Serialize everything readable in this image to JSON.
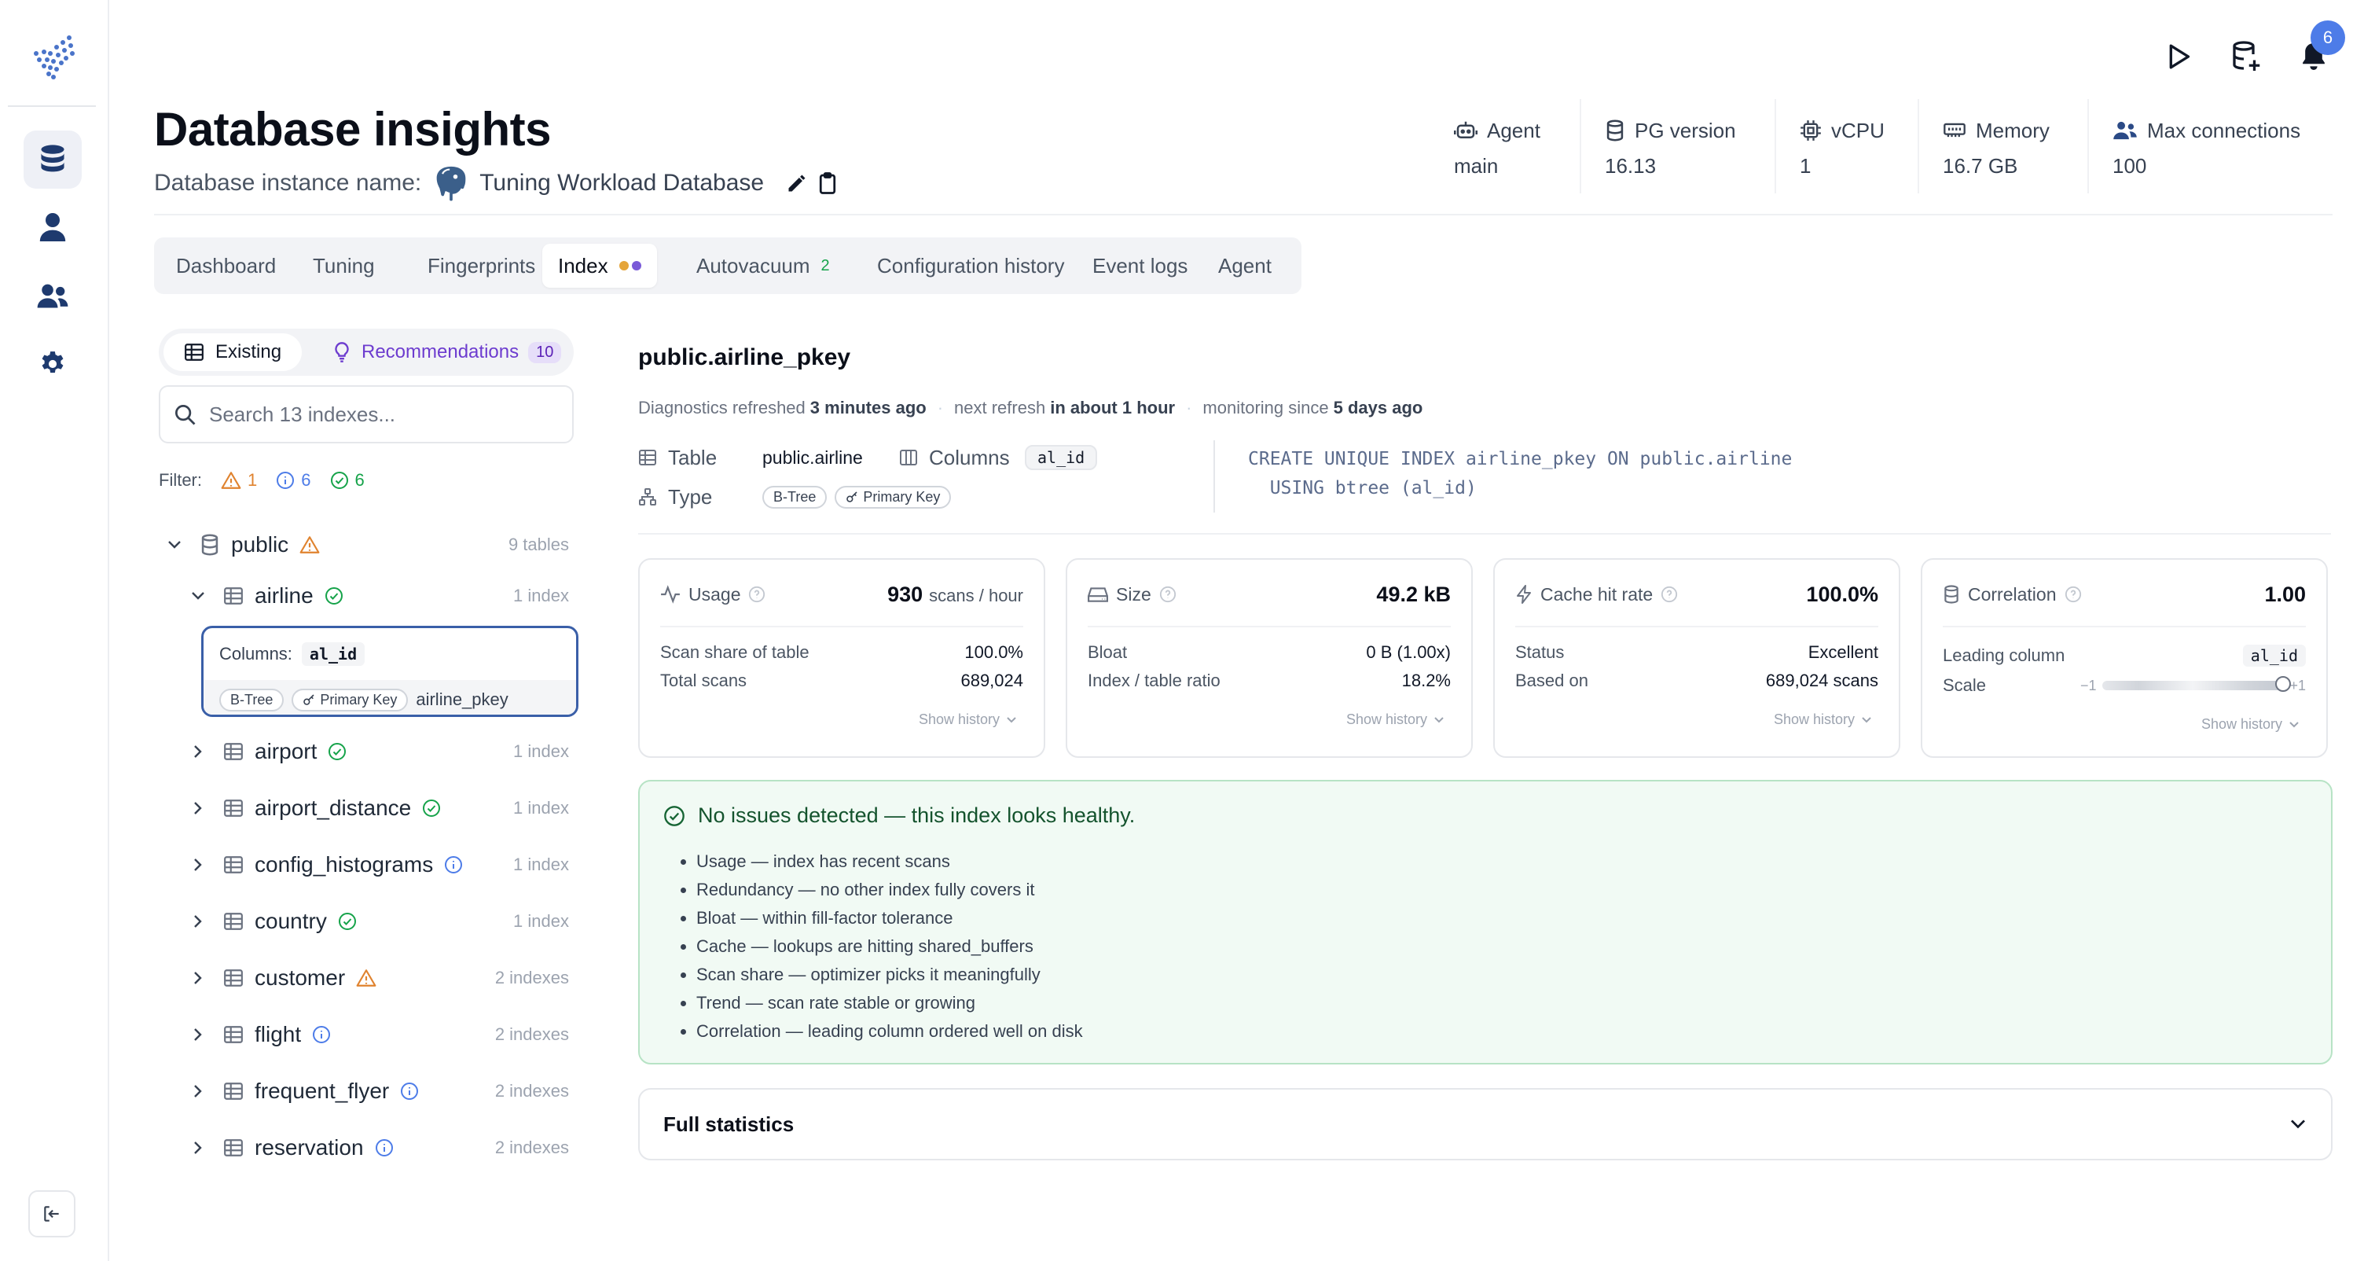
{
  "header": {
    "title": "Database insights",
    "instance_label": "Database instance name:",
    "instance_name": "Tuning Workload Database",
    "notification_count": "6"
  },
  "stats": [
    {
      "label": "Agent",
      "value": "main",
      "icon": "robot-icon"
    },
    {
      "label": "PG version",
      "value": "16.13",
      "icon": "database-icon"
    },
    {
      "label": "vCPU",
      "value": "1",
      "icon": "cpu-icon"
    },
    {
      "label": "Memory",
      "value": "16.7 GB",
      "icon": "memory-icon"
    },
    {
      "label": "Max connections",
      "value": "100",
      "icon": "users-icon"
    }
  ],
  "tabs": {
    "dashboard": "Dashboard",
    "tuning": "Tuning",
    "fingerprints": "Fingerprints",
    "index": "Index",
    "autovacuum": "Autovacuum",
    "autovacuum_count": "2",
    "config_history": "Configuration history",
    "event_logs": "Event logs",
    "agent": "Agent"
  },
  "left": {
    "existing_label": "Existing",
    "recommendations_label": "Recommendations",
    "recommendations_count": "10",
    "search_placeholder": "Search 13 indexes...",
    "filter_label": "Filter:",
    "filter_warning": "1",
    "filter_info": "6",
    "filter_ok": "6",
    "schema": {
      "name": "public",
      "count": "9 tables"
    },
    "tables": [
      {
        "name": "airline",
        "count": "1 index",
        "status": "ok",
        "expanded": true
      },
      {
        "name": "airport",
        "count": "1 index",
        "status": "ok"
      },
      {
        "name": "airport_distance",
        "count": "1 index",
        "status": "ok"
      },
      {
        "name": "config_histograms",
        "count": "1 index",
        "status": "info"
      },
      {
        "name": "country",
        "count": "1 index",
        "status": "ok"
      },
      {
        "name": "customer",
        "count": "2 indexes",
        "status": "warning"
      },
      {
        "name": "flight",
        "count": "2 indexes",
        "status": "info"
      },
      {
        "name": "frequent_flyer",
        "count": "2 indexes",
        "status": "info"
      },
      {
        "name": "reservation",
        "count": "2 indexes",
        "status": "info"
      }
    ],
    "selected_index": {
      "columns_label": "Columns:",
      "columns": "al_id",
      "type": "B-Tree",
      "kind": "Primary Key",
      "name": "airline_pkey"
    }
  },
  "detail": {
    "title": "public.airline_pkey",
    "meta_refreshed": "Diagnostics refreshed",
    "meta_refreshed_val": "3 minutes ago",
    "meta_next": "next refresh",
    "meta_next_val": "in about 1 hour",
    "meta_since": "monitoring since",
    "meta_since_val": "5 days ago",
    "table_label": "Table",
    "table_value": "public.airline",
    "columns_label": "Columns",
    "columns_value": "al_id",
    "type_label": "Type",
    "type_value": "B-Tree",
    "kind_value": "Primary Key",
    "sql_line1": "CREATE UNIQUE INDEX airline_pkey ON public.airline",
    "sql_line2": "  USING btree (al_id)"
  },
  "cards": {
    "usage": {
      "title": "Usage",
      "value": "930",
      "unit": "scans / hour",
      "r1_label": "Scan share of table",
      "r1_value": "100.0%",
      "r2_label": "Total scans",
      "r2_value": "689,024",
      "history": "Show history"
    },
    "size": {
      "title": "Size",
      "value": "49.2 kB",
      "r1_label": "Bloat",
      "r1_value": "0 B (1.00x)",
      "r2_label": "Index / table ratio",
      "r2_value": "18.2%",
      "history": "Show history"
    },
    "cache": {
      "title": "Cache hit rate",
      "value": "100.0%",
      "r1_label": "Status",
      "r1_value": "Excellent",
      "r2_label": "Based on",
      "r2_value": "689,024 scans",
      "history": "Show history"
    },
    "correlation": {
      "title": "Correlation",
      "value": "1.00",
      "r1_label": "Leading column",
      "r1_value": "al_id",
      "r2_label": "Scale",
      "scale_min": "−1",
      "scale_max": "+1",
      "scale_level": 1.0,
      "history": "Show history"
    }
  },
  "healthy": {
    "title": "No issues detected — this index looks healthy.",
    "items": [
      "Usage — index has recent scans",
      "Redundancy — no other index fully covers it",
      "Bloat — within fill-factor tolerance",
      "Cache — lookups are hitting shared_buffers",
      "Scan share — optimizer picks it meaningfully",
      "Trend — scan rate stable or growing",
      "Correlation — leading column ordered well on disk"
    ]
  },
  "full_stats": {
    "label": "Full statistics"
  },
  "colors": {
    "accent": "#3a5fa8",
    "ok": "#16a34a",
    "warning": "#e0832f",
    "info": "#4d7ce8",
    "recommend": "#6d3ccf"
  }
}
